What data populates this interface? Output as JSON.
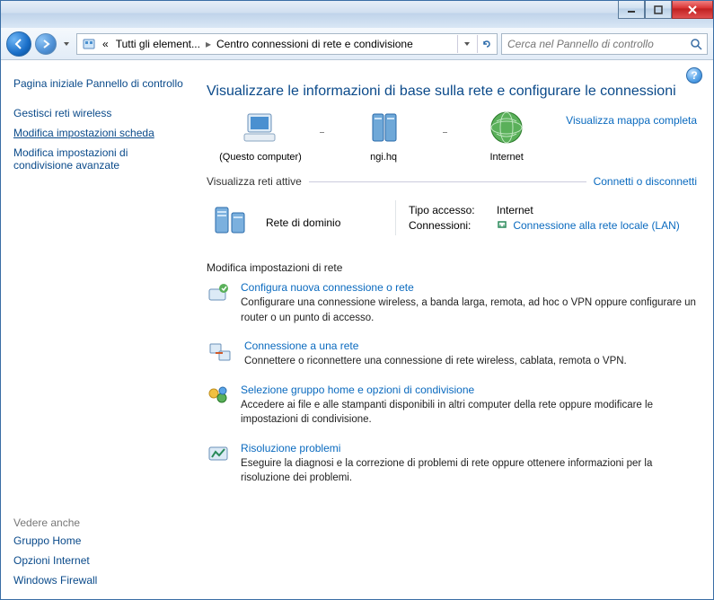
{
  "breadcrumb": {
    "prefix": "«",
    "a": "Tutti gli element...",
    "b": "Centro connessioni di rete e condivisione"
  },
  "search": {
    "placeholder": "Cerca nel Pannello di controllo"
  },
  "sidebar": {
    "home": "Pagina iniziale Pannello di controllo",
    "links": [
      "Gestisci reti wireless",
      "Modifica impostazioni scheda",
      "Modifica impostazioni di condivisione avanzate"
    ],
    "see_also": "Vedere anche",
    "bottom": [
      "Gruppo Home",
      "Opzioni Internet",
      "Windows Firewall"
    ]
  },
  "heading": "Visualizzare le informazioni di base sulla rete e configurare le connessioni",
  "map": {
    "pc": "(Questo computer)",
    "gw": "ngi.hq",
    "inet": "Internet",
    "full": "Visualizza mappa completa"
  },
  "active_section": {
    "title": "Visualizza reti attive",
    "action": "Connetti o disconnetti",
    "name": "Rete di dominio",
    "access_k": "Tipo accesso:",
    "access_v": "Internet",
    "conn_k": "Connessioni:",
    "conn_v": "Connessione alla rete locale (LAN)"
  },
  "settings_hdr": "Modifica impostazioni di rete",
  "tasks": [
    {
      "t": "Configura nuova connessione o rete",
      "d": "Configurare una connessione wireless, a banda larga, remota, ad hoc o VPN oppure configurare un router o un punto di accesso."
    },
    {
      "t": "Connessione a una rete",
      "d": "Connettere o riconnettere una connessione di rete wireless, cablata, remota o VPN."
    },
    {
      "t": "Selezione gruppo home e opzioni di condivisione",
      "d": "Accedere ai file e alle stampanti disponibili in altri computer della rete oppure modificare le impostazioni di condivisione."
    },
    {
      "t": "Risoluzione problemi",
      "d": "Eseguire la diagnosi e la correzione di problemi di rete oppure ottenere informazioni per la risoluzione dei problemi."
    }
  ]
}
